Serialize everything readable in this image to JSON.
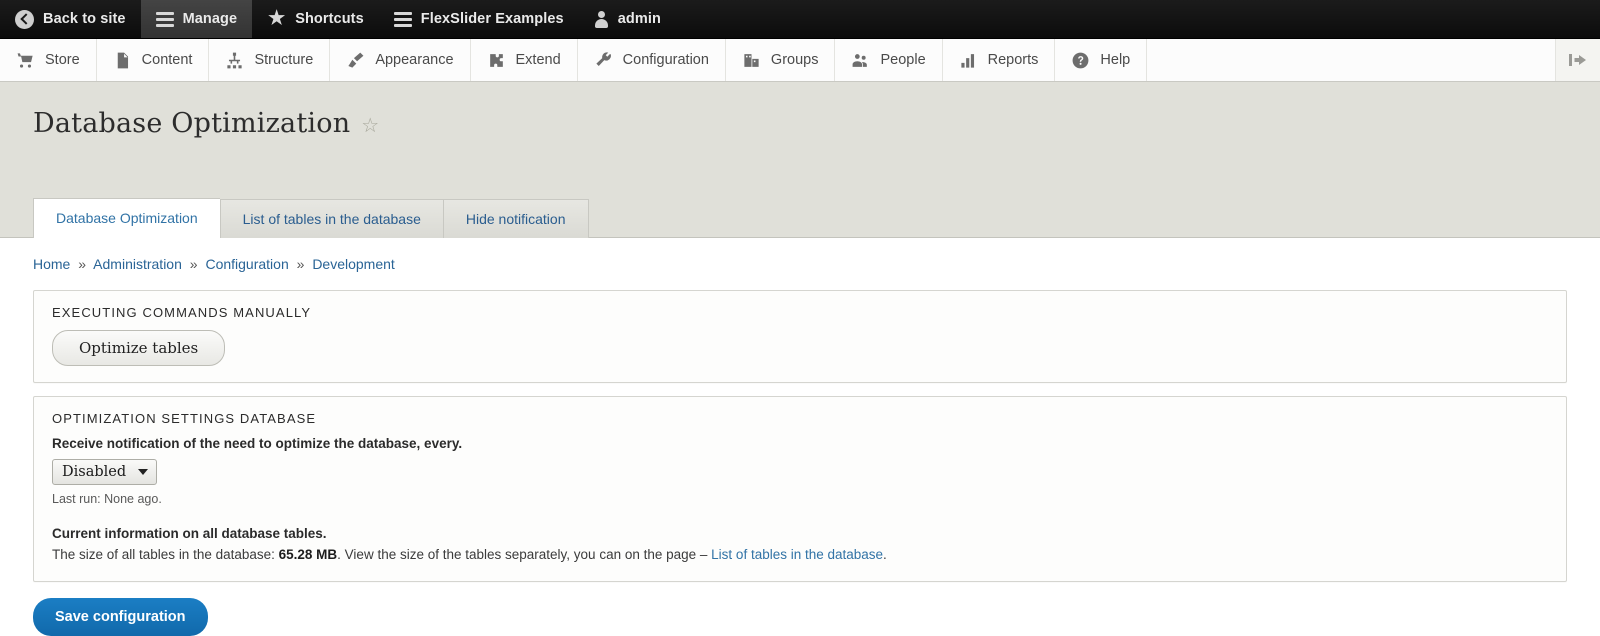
{
  "admin_bar": {
    "items": [
      {
        "label": "Back to site",
        "icon": "back-arrow-icon",
        "active": false
      },
      {
        "label": "Manage",
        "icon": "hamburger-icon",
        "active": true
      },
      {
        "label": "Shortcuts",
        "icon": "star-icon",
        "active": false
      },
      {
        "label": "FlexSlider Examples",
        "icon": "hamburger-icon",
        "active": false
      },
      {
        "label": "admin",
        "icon": "person-icon",
        "active": false
      }
    ]
  },
  "menu_bar": {
    "items": [
      {
        "label": "Store",
        "icon": "cart-icon"
      },
      {
        "label": "Content",
        "icon": "document-icon"
      },
      {
        "label": "Structure",
        "icon": "hierarchy-icon"
      },
      {
        "label": "Appearance",
        "icon": "paintbrush-icon"
      },
      {
        "label": "Extend",
        "icon": "puzzle-icon"
      },
      {
        "label": "Configuration",
        "icon": "wrench-icon"
      },
      {
        "label": "Groups",
        "icon": "groups-icon"
      },
      {
        "label": "People",
        "icon": "people-icon"
      },
      {
        "label": "Reports",
        "icon": "bar-chart-icon"
      },
      {
        "label": "Help",
        "icon": "question-mark-icon"
      }
    ],
    "orientation_toggle_icon": "toolbar-orientation-toggle-icon"
  },
  "page": {
    "title": "Database Optimization",
    "favorite_icon": "star-outline-icon"
  },
  "tabs": [
    {
      "label": "Database Optimization",
      "active": true
    },
    {
      "label": "List of tables in the database",
      "active": false
    },
    {
      "label": "Hide notification",
      "active": false
    }
  ],
  "breadcrumb": {
    "separator": "»",
    "items": [
      "Home",
      "Administration",
      "Configuration",
      "Development"
    ]
  },
  "fieldset_manual": {
    "legend": "EXECUTING COMMANDS MANUALLY",
    "optimize_button": "Optimize tables"
  },
  "fieldset_settings": {
    "legend": "OPTIMIZATION SETTINGS DATABASE",
    "notification_label": "Receive notification of the need to optimize the database, every.",
    "select_value": "Disabled",
    "select_options": [
      "Disabled"
    ],
    "last_run": "Last run: None ago.",
    "current_info_label": "Current information on all database tables.",
    "size_text_prefix": "The size of all tables in the database: ",
    "size_value": "65.28 MB",
    "size_text_middle": ". View the size of the tables separately, you can on the page – ",
    "size_link": "List of tables in the database",
    "size_text_suffix": "."
  },
  "actions": {
    "save_label": "Save configuration"
  },
  "colors": {
    "admin_bar_bg": "#0f0f0f",
    "admin_bar_active": "#3a3a3a",
    "header_bg": "#e0e0d9",
    "link_blue": "#3173a6",
    "save_button_blue": "#1572b8"
  }
}
